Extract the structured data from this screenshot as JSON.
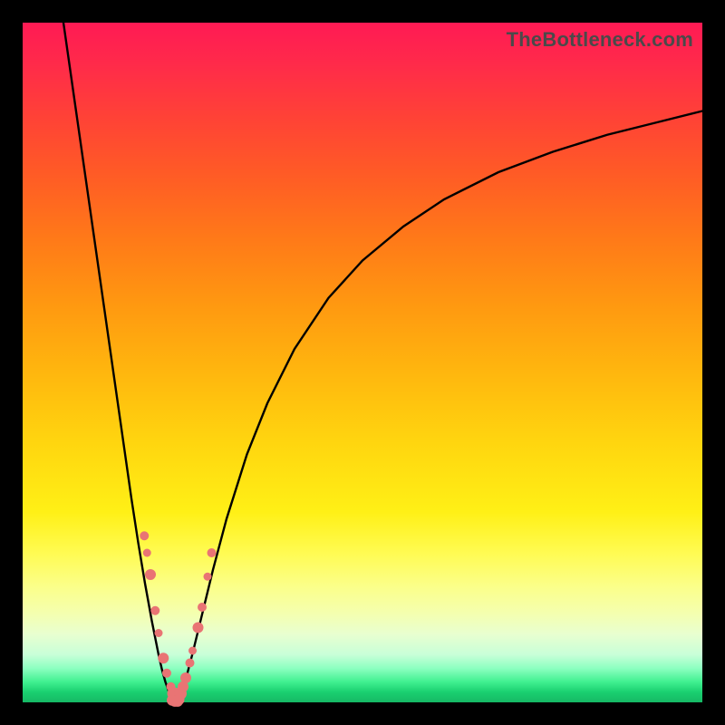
{
  "watermark": "TheBottleneck.com",
  "chart_data": {
    "type": "line",
    "title": "",
    "xlabel": "",
    "ylabel": "",
    "xlim": [
      0,
      100
    ],
    "ylim": [
      0,
      100
    ],
    "series": [
      {
        "name": "curve-left",
        "x": [
          6,
          8,
          10,
          12,
          14,
          15,
          16,
          17,
          18,
          19,
          20,
          20.5,
          21,
          21.5,
          22,
          22.5
        ],
        "y": [
          100,
          86,
          72,
          58,
          44,
          37,
          30,
          23.5,
          17.5,
          12,
          7,
          4.8,
          3.0,
          1.6,
          0.6,
          0.1
        ]
      },
      {
        "name": "curve-right",
        "x": [
          22.5,
          23,
          23.5,
          24,
          25,
          26,
          28,
          30,
          33,
          36,
          40,
          45,
          50,
          56,
          62,
          70,
          78,
          86,
          94,
          100
        ],
        "y": [
          0.1,
          0.7,
          1.8,
          3.4,
          7.2,
          11.3,
          19.5,
          27.0,
          36.5,
          44.0,
          52.0,
          59.5,
          65.0,
          70.0,
          74.0,
          78.0,
          81.0,
          83.5,
          85.5,
          87.0
        ]
      }
    ],
    "markers": [
      {
        "name": "left-dots",
        "x": [
          17.9,
          18.3,
          18.8,
          19.5,
          20.0,
          20.7,
          21.2,
          21.8,
          22.2,
          22.6
        ],
        "y": [
          24.5,
          22.0,
          18.8,
          13.5,
          10.2,
          6.5,
          4.3,
          2.3,
          1.3,
          0.8
        ],
        "size": [
          10,
          9,
          12,
          10,
          9,
          12,
          10,
          10,
          14,
          12
        ]
      },
      {
        "name": "right-dots",
        "x": [
          23.2,
          23.6,
          24.0,
          24.6,
          25.0,
          25.8,
          26.4,
          27.2,
          27.8
        ],
        "y": [
          1.3,
          2.3,
          3.6,
          5.8,
          7.6,
          11.0,
          14.0,
          18.5,
          22.0
        ],
        "size": [
          14,
          12,
          12,
          10,
          9,
          12,
          10,
          9,
          10
        ]
      },
      {
        "name": "bottom-dots",
        "x": [
          22.0,
          22.4,
          22.8,
          23.0
        ],
        "y": [
          0.3,
          0.15,
          0.15,
          0.4
        ],
        "size": [
          12,
          12,
          12,
          12
        ]
      }
    ],
    "marker_color": "#e97474"
  }
}
